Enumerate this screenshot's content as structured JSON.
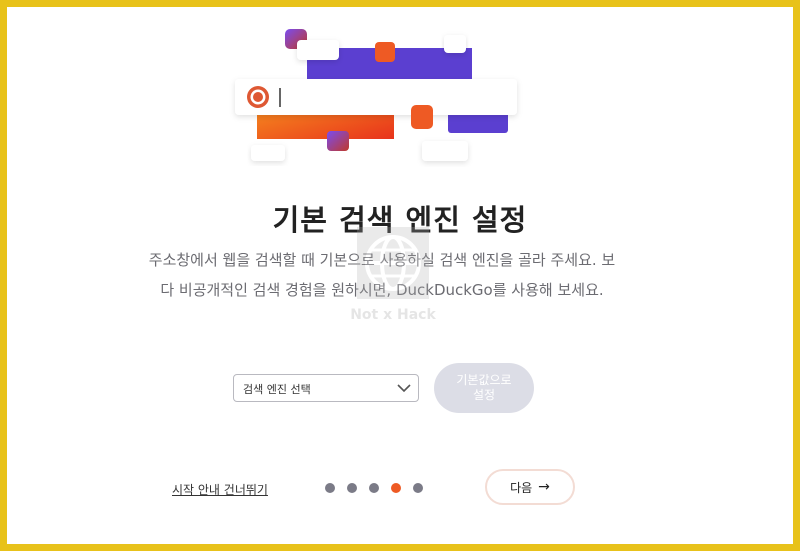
{
  "hero": {
    "address_bar_caret": "|"
  },
  "heading": {
    "title": "기본 검색 엔진 설정",
    "description": "주소창에서 웹을 검색할 때 기본으로 사용하실 검색 엔진을 골라 주세요. 보다 비공개적인 검색 경험을 원하시면, DuckDuckGo를 사용해 보세요."
  },
  "controls": {
    "engine_select_value": "검색 엔진 선택",
    "set_default_label": "기본값으로 설정"
  },
  "footer": {
    "skip_label": "시작 안내 건너뛰기",
    "next_label": "다음",
    "next_arrow": "→",
    "pagination": {
      "total": 5,
      "active_index": 3
    }
  },
  "watermark": {
    "text": "Not x Hack"
  },
  "colors": {
    "accent_orange": "#ee5a24",
    "accent_purple": "#5b3fd0",
    "frame_border": "#e8c21a",
    "button_disabled": "#dcdde6"
  }
}
